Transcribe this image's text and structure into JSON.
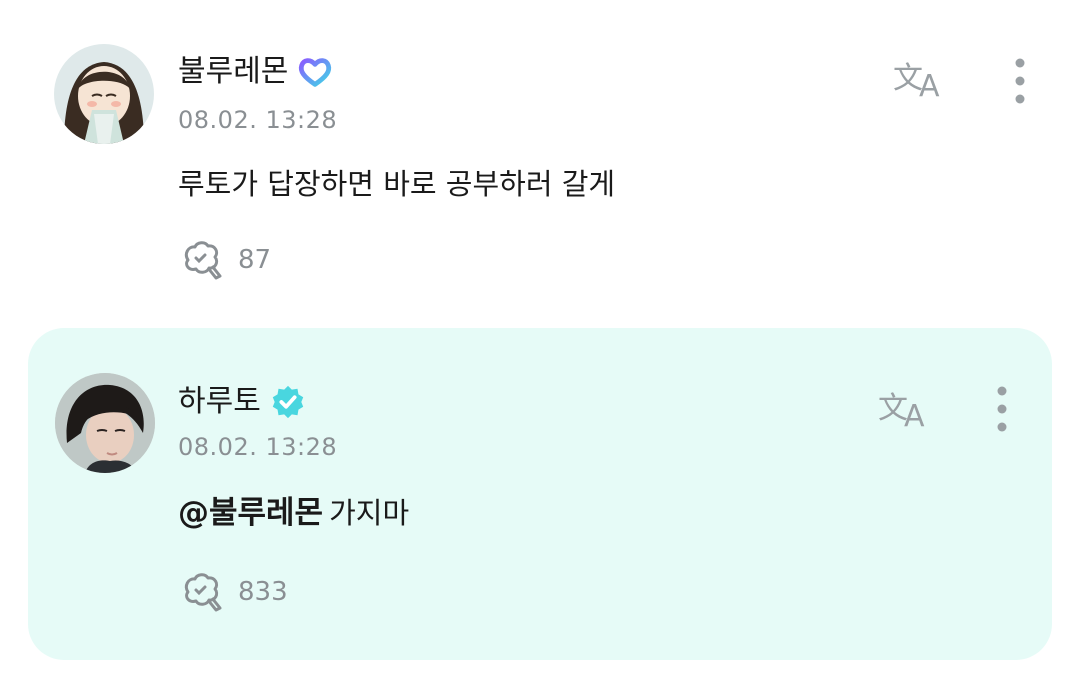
{
  "comments": [
    {
      "author": "불루레몬",
      "badge": "membership-heart-icon",
      "timestamp": "08.02. 13:28",
      "mention": "",
      "text": "루토가 답장하면 바로 공부하러 갈게",
      "like_count": "87",
      "highlighted": false
    },
    {
      "author": "하루토",
      "badge": "verified-check-icon",
      "timestamp": "08.02. 13:28",
      "mention": "@불루레몬",
      "text": "가지마",
      "like_count": "833",
      "highlighted": true
    }
  ],
  "colors": {
    "highlight_bg": "#e6fbf7",
    "verified": "#49d6df",
    "heart_gradient": [
      "#7a6cff",
      "#3fd6e6"
    ],
    "muted_text": "#8a8f93"
  },
  "icons": {
    "translate": "translate-icon",
    "more": "more-vertical-icon",
    "like": "like-bubble-icon"
  }
}
